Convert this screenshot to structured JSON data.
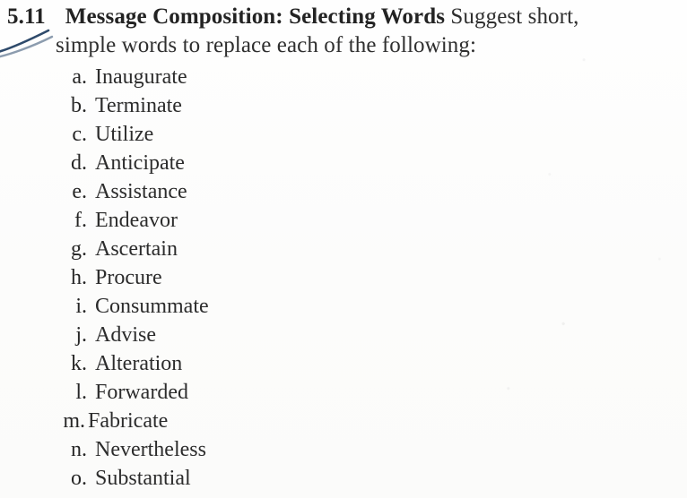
{
  "document": {
    "exercise_number": "5.11",
    "exercise_title": "Message Composition: Selecting Words",
    "prompt_line1": "Suggest short,",
    "prompt_line2": "simple words to replace each of the following:",
    "annotation": {
      "type": "handwritten-ink-stroke",
      "color": "#2e4a6b",
      "description": "double diagonal pen stroke in left margin"
    },
    "items": [
      {
        "label": "a.",
        "word": "Inaugurate"
      },
      {
        "label": "b.",
        "word": "Terminate"
      },
      {
        "label": "c.",
        "word": "Utilize"
      },
      {
        "label": "d.",
        "word": "Anticipate"
      },
      {
        "label": "e.",
        "word": "Assistance"
      },
      {
        "label": "f.",
        "word": "Endeavor"
      },
      {
        "label": "g.",
        "word": "Ascertain"
      },
      {
        "label": "h.",
        "word": "Procure"
      },
      {
        "label": "i.",
        "word": "Consummate"
      },
      {
        "label": "j.",
        "word": "Advise"
      },
      {
        "label": "k.",
        "word": "Alteration"
      },
      {
        "label": "l.",
        "word": "Forwarded"
      },
      {
        "label": "m.",
        "word": "Fabricate"
      },
      {
        "label": "n.",
        "word": "Nevertheless"
      },
      {
        "label": "o.",
        "word": "Substantial"
      }
    ]
  }
}
